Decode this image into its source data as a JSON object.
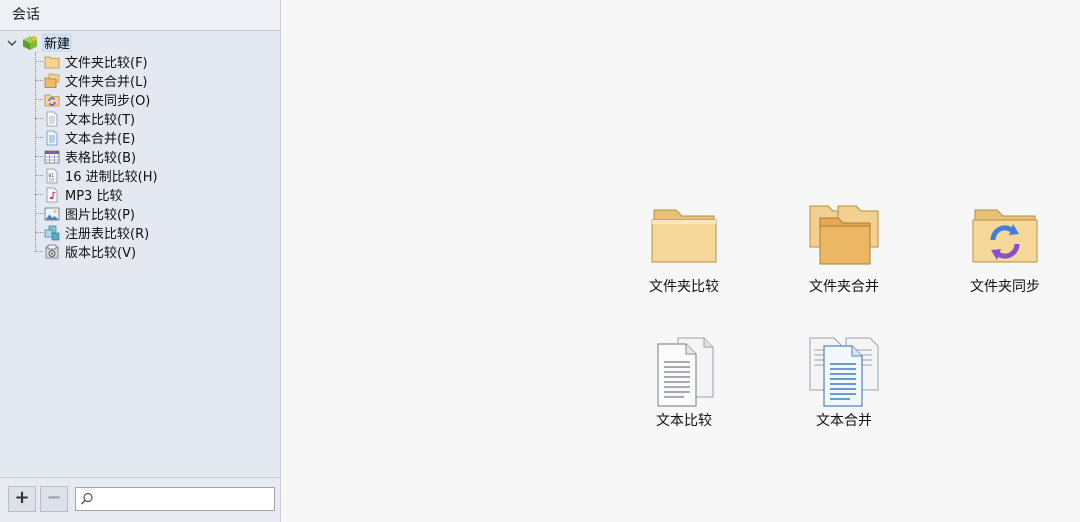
{
  "sidebar": {
    "header_title": "会话",
    "root_label": "新建",
    "items": [
      {
        "label": "文件夹比较(F)",
        "icon": "folder-icon"
      },
      {
        "label": "文件夹合并(L)",
        "icon": "folder-merge-icon"
      },
      {
        "label": "文件夹同步(O)",
        "icon": "folder-sync-icon"
      },
      {
        "label": "文本比较(T)",
        "icon": "text-doc-icon"
      },
      {
        "label": "文本合并(E)",
        "icon": "text-merge-icon"
      },
      {
        "label": "表格比较(B)",
        "icon": "table-icon"
      },
      {
        "label": "16 进制比较(H)",
        "icon": "hex-icon"
      },
      {
        "label": "MP3 比较",
        "icon": "mp3-icon"
      },
      {
        "label": "图片比较(P)",
        "icon": "picture-icon"
      },
      {
        "label": "注册表比较(R)",
        "icon": "registry-icon"
      },
      {
        "label": "版本比较(V)",
        "icon": "version-icon"
      }
    ],
    "footer": {
      "add_label": "+",
      "remove_label": "−",
      "search_placeholder": ""
    }
  },
  "main": {
    "tiles": [
      {
        "label": "文件夹比较",
        "icon": "folder-compare-large-icon"
      },
      {
        "label": "文件夹合并",
        "icon": "folder-merge-large-icon"
      },
      {
        "label": "文件夹同步",
        "icon": "folder-sync-large-icon"
      },
      {
        "label": "文本比较",
        "icon": "text-compare-large-icon"
      },
      {
        "label": "文本合并",
        "icon": "text-merge-large-icon"
      }
    ]
  },
  "colors": {
    "sidebar_bg": "#e4e9f1",
    "selection_bg": "#cfe0f5",
    "main_bg": "#f7f7f7",
    "folder_tan": "#f3cf85",
    "sync_purple": "#8a4fc9",
    "sync_blue": "#3f7fd9"
  }
}
